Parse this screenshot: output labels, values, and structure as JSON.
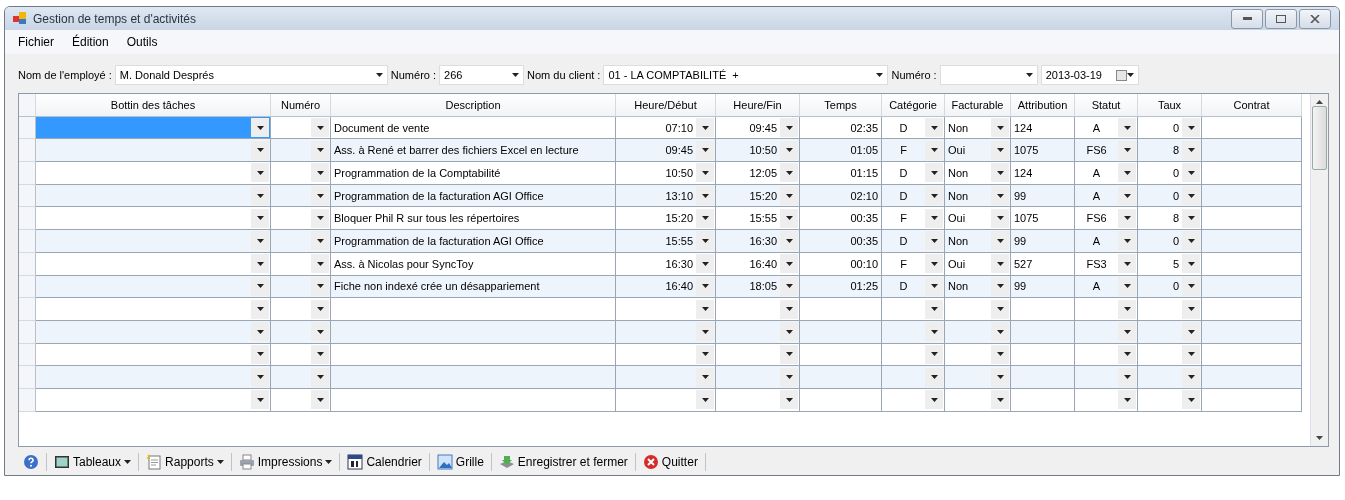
{
  "window": {
    "title": "Gestion de temps et d'activités"
  },
  "menu": [
    "Fichier",
    "Édition",
    "Outils"
  ],
  "filters": [
    {
      "label": "Nom de l'employé :",
      "value": "M. Donald Després",
      "kind": "combo"
    },
    {
      "label": "Numéro :",
      "value": "266",
      "kind": "combo"
    },
    {
      "label": "Nom du client :",
      "value": "01 - LA COMPTABILITÉ  +",
      "kind": "combo"
    },
    {
      "label": "Numéro :",
      "kind": "combo"
    },
    {
      "value": "2013-03-19",
      "kind": "date"
    }
  ],
  "columns": [
    {
      "label": "Bottin des tâches",
      "kind": "combo"
    },
    {
      "label": "Numéro",
      "kind": "combo"
    },
    {
      "label": "Description",
      "kind": "text"
    },
    {
      "label": "Heure/Début",
      "kind": "combo"
    },
    {
      "label": "Heure/Fin",
      "kind": "combo"
    },
    {
      "label": "Temps",
      "kind": "text"
    },
    {
      "label": "Catégorie",
      "kind": "combo"
    },
    {
      "label": "Facturable",
      "kind": "combo"
    },
    {
      "label": "Attribution",
      "kind": "text"
    },
    {
      "label": "Statut",
      "kind": "combo"
    },
    {
      "label": "Taux",
      "kind": "combo"
    },
    {
      "label": "Contrat",
      "kind": "text"
    }
  ],
  "rows": [
    {
      "selected": true,
      "cells": [
        "Document de vente",
        "07:10",
        "09:45",
        "02:35",
        "D",
        "Non",
        "124",
        "A",
        "0"
      ]
    },
    {
      "selected": false,
      "cells": [
        "Ass. à René et barrer des fichiers Excel en lecture",
        "09:45",
        "10:50",
        "01:05",
        "F",
        "Oui",
        "1075",
        "FS6",
        "8"
      ]
    },
    {
      "selected": false,
      "cells": [
        "Programmation de la Comptabilité",
        "10:50",
        "12:05",
        "01:15",
        "D",
        "Non",
        "124",
        "A",
        "0"
      ]
    },
    {
      "selected": false,
      "cells": [
        "Programmation de la facturation AGI Office",
        "13:10",
        "15:20",
        "02:10",
        "D",
        "Non",
        "99",
        "A",
        "0"
      ]
    },
    {
      "selected": false,
      "cells": [
        "Bloquer Phil R sur tous les répertoires",
        "15:20",
        "15:55",
        "00:35",
        "F",
        "Oui",
        "1075",
        "FS6",
        "8"
      ]
    },
    {
      "selected": false,
      "cells": [
        "Programmation de la facturation AGI Office",
        "15:55",
        "16:30",
        "00:35",
        "D",
        "Non",
        "99",
        "A",
        "0"
      ]
    },
    {
      "selected": false,
      "cells": [
        "Ass. à Nicolas pour SyncToy",
        "16:30",
        "16:40",
        "00:10",
        "F",
        "Oui",
        "527",
        "FS3",
        "5"
      ]
    },
    {
      "selected": false,
      "cells": [
        "Fiche non indexé crée un désappariement",
        "16:40",
        "18:05",
        "01:25",
        "D",
        "Non",
        "99",
        "A",
        "0"
      ]
    },
    {
      "selected": false
    },
    {
      "selected": false
    },
    {
      "selected": false
    },
    {
      "selected": false
    },
    {
      "selected": false
    }
  ],
  "toolbar": [
    {
      "kind": "help",
      "dropdown": false
    },
    {
      "kind": "tables",
      "label": "Tableaux",
      "dropdown": true
    },
    {
      "kind": "reports",
      "label": "Rapports",
      "dropdown": true
    },
    {
      "kind": "print",
      "label": "Impressions",
      "dropdown": true
    },
    {
      "kind": "calendar",
      "label": "Calendrier",
      "dropdown": false
    },
    {
      "kind": "grid",
      "label": "Grille",
      "dropdown": false
    },
    {
      "kind": "save",
      "label": "Enregistrer et fermer",
      "dropdown": false
    },
    {
      "kind": "quit",
      "label": "Quitter",
      "dropdown": false
    }
  ]
}
